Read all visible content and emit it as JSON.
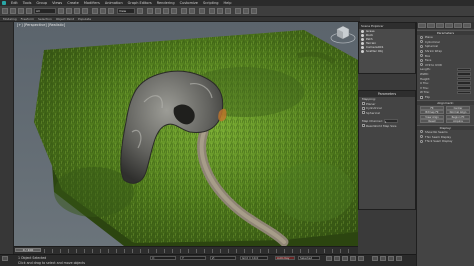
{
  "menubar": {
    "items": [
      "Edit",
      "Tools",
      "Group",
      "Views",
      "Create",
      "Modifiers",
      "Animation",
      "Graph Editors",
      "Rendering",
      "Customize",
      "Scripting",
      "Help"
    ]
  },
  "toolbar": {
    "selection_filter": "All",
    "coord_system": "View"
  },
  "ribbon": {
    "tabs": [
      "Modeling",
      "Freeform",
      "Selection",
      "Object Paint",
      "Populate"
    ]
  },
  "viewport": {
    "label": "[+] [Perspective] [Realistic]"
  },
  "scene_explorer": {
    "title": "Scene Explorer",
    "items": [
      "Grass",
      "Rock",
      "Path",
      "Terrain",
      "Camera001",
      "Scatter Obj"
    ]
  },
  "parameters": {
    "title": "Parameters",
    "mapping_label": "Mapping:",
    "options": [
      "Planar",
      "Cylindrical",
      "Spherical"
    ],
    "channel_label": "Map Channel:",
    "channel_value": "1",
    "real_world": "Real-World Map Size"
  },
  "command_panel": {
    "rollout_object_type": "Object Type",
    "name_color": "Name and Color",
    "radios": [
      "Plane",
      "Cylindrical",
      "Spherical",
      "Shrink Wrap",
      "Box",
      "Face",
      "XYZ to UVW"
    ],
    "params_title": "Parameters",
    "spinners": [
      "Length:",
      "Width:",
      "Height:",
      "U Tile:",
      "V Tile:",
      "W Tile:"
    ],
    "flip_label": "Flip",
    "alignment_title": "Alignment:",
    "align_buttons": [
      "Fit",
      "Center",
      "Bitmap Fit",
      "Normal Align",
      "View Align",
      "Region Fit",
      "Reset",
      "Acquire"
    ],
    "display_title": "Display:",
    "display_options": [
      "Show No Seams",
      "Thin Seam Display",
      "Thick Seam Display"
    ]
  },
  "timeline": {
    "slider_label": "0 / 100"
  },
  "status": {
    "selected": "1 Object Selected",
    "prompt": "Click and drag to select and move objects",
    "x_label": "X:",
    "y_label": "Y:",
    "z_label": "Z:",
    "grid_label": "Grid = 10.0",
    "autokey_label": "Auto Key",
    "selected_label": "Selected"
  },
  "colors": {
    "grass_light": "#6fa02c",
    "grass_dark": "#2f4a10",
    "rock": "#6e6e6a",
    "path": "#9b8f7e",
    "viewport_bg": "#5f6a72"
  }
}
